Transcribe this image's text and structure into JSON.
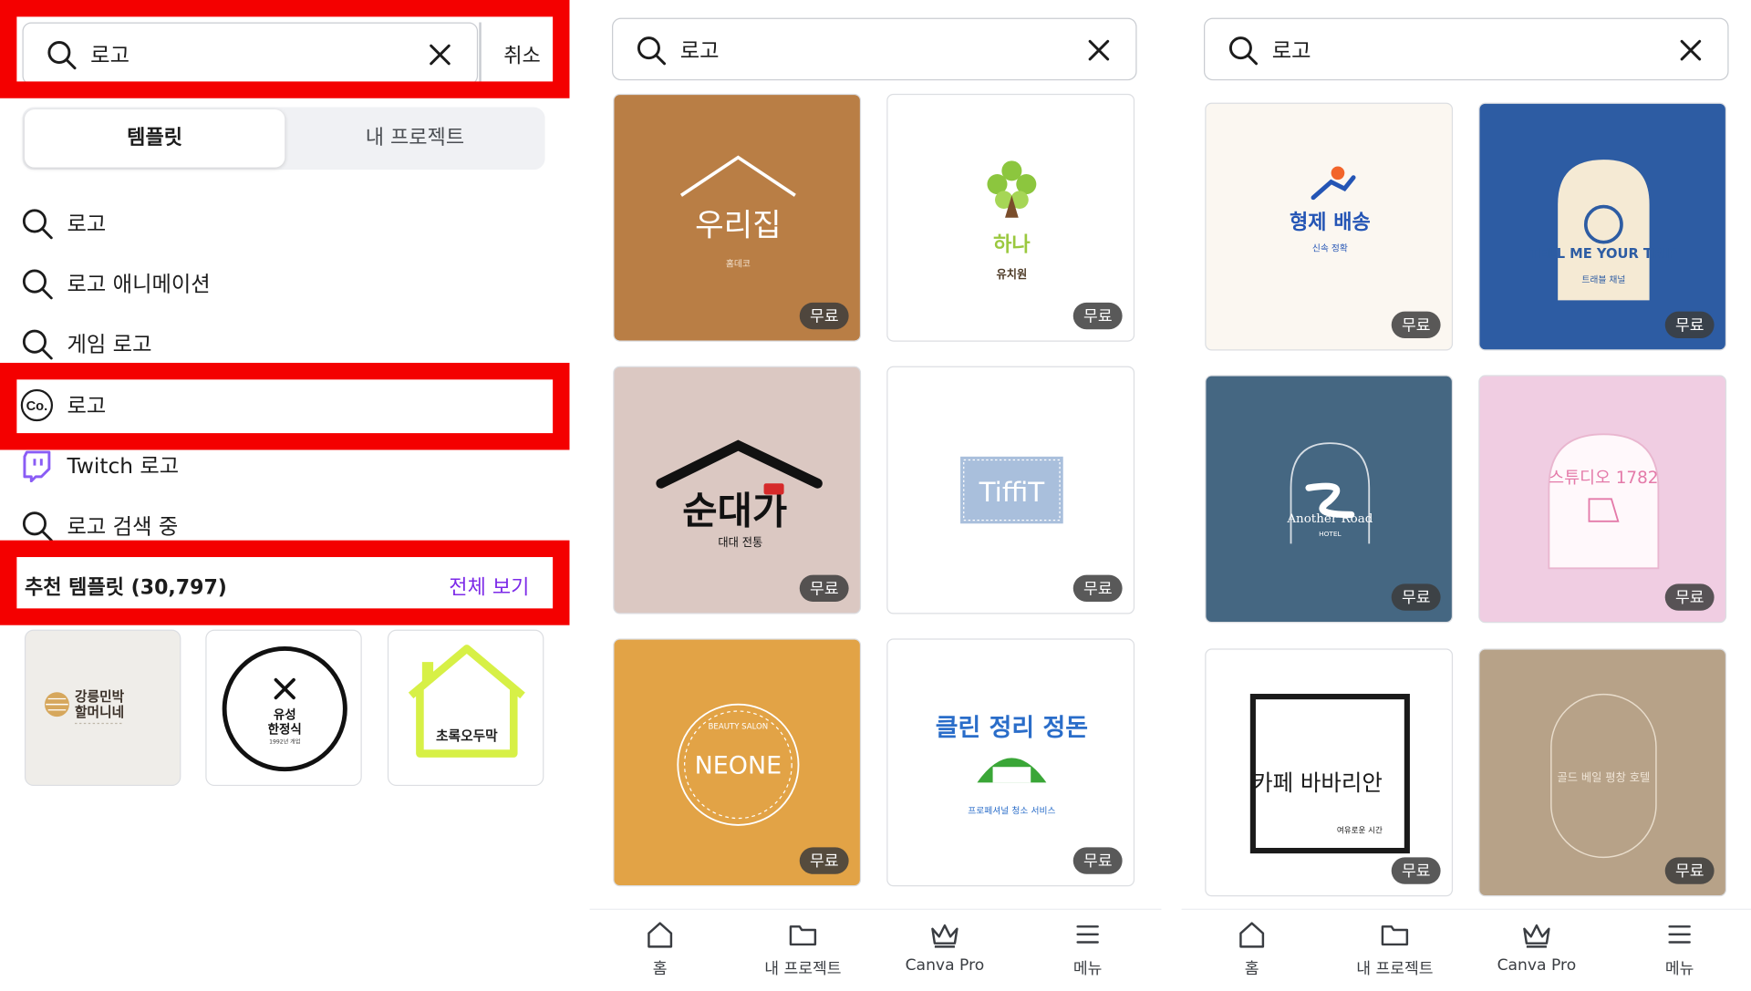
{
  "search_query": "로고",
  "panel1": {
    "cancel_label": "취소",
    "tabs": [
      {
        "label": "템플릿"
      },
      {
        "label": "내 프로젝트"
      }
    ],
    "suggestions": [
      {
        "label": "로고",
        "icon": "search-icon"
      },
      {
        "label": "로고 애니메이션",
        "icon": "search-icon"
      },
      {
        "label": "게임 로고",
        "icon": "search-icon"
      },
      {
        "label": "로고",
        "icon": "canva-co-icon"
      },
      {
        "label": "Twitch 로고",
        "icon": "twitch-icon"
      },
      {
        "label": "로고 검색 중",
        "icon": "search-icon"
      }
    ],
    "recommended": {
      "title": "추천 템플릿 (30,797)",
      "see_all": "전체 보기"
    },
    "thumbnails": [
      {
        "line1": "강릉민박",
        "line2": "할머니네"
      },
      {
        "line1": "유성",
        "line2": "한정식",
        "line3": "1992년 개업"
      },
      {
        "line1": "초록오두막"
      }
    ]
  },
  "badge_label": "무료",
  "panel2": {
    "cards": [
      {
        "bg": "#b97e45",
        "title": "우리집",
        "subtitle": "홈데코"
      },
      {
        "bg": "#ffffff",
        "title": "하나",
        "subtitle": "유치원"
      },
      {
        "bg": "#dbc8c2",
        "title": "순대가",
        "subtitle": "대대 전통"
      },
      {
        "bg": "#ffffff",
        "title": "TiffiT"
      },
      {
        "bg": "#e2a346",
        "title": "NEONE",
        "subtitle": "BEAUTY SALON"
      },
      {
        "bg": "#ffffff",
        "title": "클린 정리 정돈",
        "subtitle": "프로페셔널 청소 서비스"
      }
    ]
  },
  "panel3": {
    "cards": [
      {
        "bg": "#fbf7f1",
        "title": "형제 배송",
        "subtitle": "신속 정확"
      },
      {
        "bg": "#2d5ca3",
        "title": "TELL ME YOUR TRIP",
        "subtitle": "트래블 채널"
      },
      {
        "bg": "#456782",
        "title": "Another Road",
        "subtitle": "HOTEL"
      },
      {
        "bg": "#f0cde2",
        "title": "스튜디오 1782"
      },
      {
        "bg": "#ffffff",
        "title": "카페 바바리안",
        "subtitle": "여유로운 시간"
      },
      {
        "bg": "#b7a288",
        "title": "골드 베일 평창 호텔"
      }
    ]
  },
  "nav": [
    {
      "label": "홈",
      "icon": "home-icon"
    },
    {
      "label": "내 프로젝트",
      "icon": "folder-icon"
    },
    {
      "label": "Canva Pro",
      "icon": "crown-icon"
    },
    {
      "label": "메뉴",
      "icon": "menu-icon"
    }
  ]
}
